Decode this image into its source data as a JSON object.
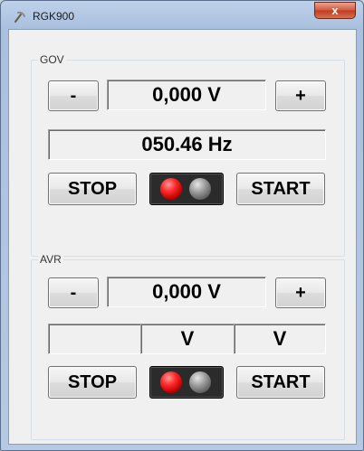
{
  "window": {
    "title": "RGK900",
    "close_label": "x"
  },
  "gov": {
    "legend": "GOV",
    "minus_label": "-",
    "plus_label": "+",
    "voltage_value": "0,000 V",
    "frequency_value": "050.46 Hz",
    "stop_label": "STOP",
    "start_label": "START",
    "lamps": {
      "left": "red",
      "right": "grey"
    }
  },
  "avr": {
    "legend": "AVR",
    "minus_label": "-",
    "plus_label": "+",
    "voltage_value": "0,000 V",
    "readings": [
      "",
      "V",
      "V"
    ],
    "stop_label": "STOP",
    "start_label": "START",
    "lamps": {
      "left": "red",
      "right": "grey"
    }
  },
  "colors": {
    "lamp_on": "#ff2b2b",
    "lamp_off": "#8a8a8a",
    "close_button": "#c9452a"
  },
  "icons": {
    "app": "pickaxe-icon",
    "close": "close-icon"
  }
}
